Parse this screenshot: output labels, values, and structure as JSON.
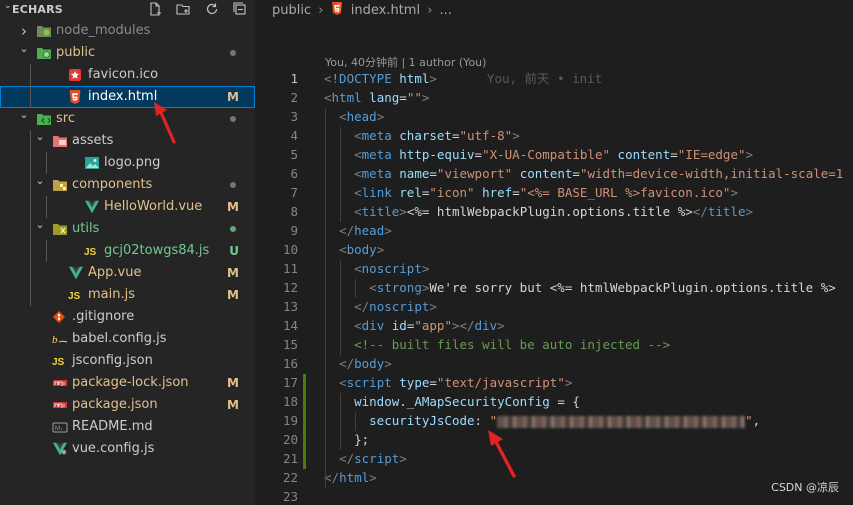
{
  "explorer": {
    "title": "ECHARS",
    "tree": [
      {
        "name": "node_modules",
        "icon": "node-folder-icon",
        "kind": "folder",
        "depth": 0,
        "open": false,
        "color": "#8b8b8b",
        "badge": "",
        "dot": false
      },
      {
        "name": "public",
        "icon": "public-folder-icon",
        "kind": "folder",
        "depth": 0,
        "open": true,
        "color": "#e2c08d",
        "badge": "",
        "dot": true
      },
      {
        "name": "favicon.ico",
        "icon": "favicon-icon",
        "kind": "file",
        "depth": 1,
        "color": "#cccccc",
        "badge": "",
        "dot": false
      },
      {
        "name": "index.html",
        "icon": "html5-icon",
        "kind": "file",
        "depth": 1,
        "color": "#e2c08d",
        "badge": "M",
        "badgeColor": "#e2c08d",
        "dot": false,
        "selected": true
      },
      {
        "name": "src",
        "icon": "src-folder-icon",
        "kind": "folder",
        "depth": 0,
        "open": true,
        "color": "#e2c08d",
        "badge": "",
        "dot": true
      },
      {
        "name": "assets",
        "icon": "assets-folder-icon",
        "kind": "folder",
        "depth": 1,
        "open": true,
        "color": "#cccccc",
        "badge": "",
        "dot": false
      },
      {
        "name": "logo.png",
        "icon": "image-icon",
        "kind": "file",
        "depth": 2,
        "color": "#cccccc",
        "badge": "",
        "dot": false
      },
      {
        "name": "components",
        "icon": "components-folder-icon",
        "kind": "folder",
        "depth": 1,
        "open": true,
        "color": "#e2c08d",
        "badge": "",
        "dot": true
      },
      {
        "name": "HelloWorld.vue",
        "icon": "vue-icon",
        "kind": "file",
        "depth": 2,
        "color": "#e2c08d",
        "badge": "M",
        "badgeColor": "#e2c08d",
        "dot": false
      },
      {
        "name": "utils",
        "icon": "utils-folder-icon",
        "kind": "folder",
        "depth": 1,
        "open": true,
        "color": "#73c991",
        "badge": "",
        "dot": true,
        "dotColor": "#73c991"
      },
      {
        "name": "gcj02towgs84.js",
        "icon": "js-icon",
        "kind": "file",
        "depth": 2,
        "color": "#73c991",
        "badge": "U",
        "badgeColor": "#73c991",
        "dot": false
      },
      {
        "name": "App.vue",
        "icon": "vue-icon",
        "kind": "file",
        "depth": 1,
        "color": "#e2c08d",
        "badge": "M",
        "badgeColor": "#e2c08d",
        "dot": false
      },
      {
        "name": "main.js",
        "icon": "js-icon",
        "kind": "file",
        "depth": 1,
        "color": "#e2c08d",
        "badge": "M",
        "badgeColor": "#e2c08d",
        "dot": false
      },
      {
        "name": ".gitignore",
        "icon": "git-icon",
        "kind": "file",
        "depth": 0,
        "color": "#cccccc",
        "badge": "",
        "dot": false
      },
      {
        "name": "babel.config.js",
        "icon": "babel-icon",
        "kind": "file",
        "depth": 0,
        "color": "#cccccc",
        "badge": "",
        "dot": false
      },
      {
        "name": "jsconfig.json",
        "icon": "js-icon",
        "kind": "file",
        "depth": 0,
        "color": "#cccccc",
        "badge": "",
        "dot": false
      },
      {
        "name": "package-lock.json",
        "icon": "npm-icon",
        "kind": "file",
        "depth": 0,
        "color": "#e2c08d",
        "badge": "M",
        "badgeColor": "#e2c08d",
        "dot": false
      },
      {
        "name": "package.json",
        "icon": "npm-icon",
        "kind": "file",
        "depth": 0,
        "color": "#e2c08d",
        "badge": "M",
        "badgeColor": "#e2c08d",
        "dot": false
      },
      {
        "name": "README.md",
        "icon": "markdown-icon",
        "kind": "file",
        "depth": 0,
        "color": "#cccccc",
        "badge": "",
        "dot": false
      },
      {
        "name": "vue.config.js",
        "icon": "vue-config-icon",
        "kind": "file",
        "depth": 0,
        "color": "#cccccc",
        "badge": "",
        "dot": false
      }
    ]
  },
  "breadcrumb": {
    "folder": "public",
    "file": "index.html",
    "more": "..."
  },
  "blame": "You, 40分钟前 | 1 author (You)",
  "ghost_text": "You, 前天 • init",
  "code": [
    [
      [
        "t-punc",
        "<"
      ],
      [
        "t-tag",
        "!DOCTYPE"
      ],
      [
        "t-text",
        " "
      ],
      [
        "t-attr",
        "html"
      ],
      [
        "t-punc",
        ">"
      ]
    ],
    [
      [
        "t-punc",
        "<"
      ],
      [
        "t-tag",
        "html"
      ],
      [
        "t-text",
        " "
      ],
      [
        "t-attr",
        "lang"
      ],
      [
        "t-text",
        "="
      ],
      [
        "t-str",
        "\"\""
      ],
      [
        "t-punc",
        ">"
      ]
    ],
    [
      [
        "t-text",
        "  "
      ],
      [
        "t-punc",
        "<"
      ],
      [
        "t-tag",
        "head"
      ],
      [
        "t-punc",
        ">"
      ]
    ],
    [
      [
        "t-text",
        "    "
      ],
      [
        "t-punc",
        "<"
      ],
      [
        "t-tag",
        "meta"
      ],
      [
        "t-text",
        " "
      ],
      [
        "t-attr",
        "charset"
      ],
      [
        "t-text",
        "="
      ],
      [
        "t-str",
        "\"utf-8\""
      ],
      [
        "t-punc",
        ">"
      ]
    ],
    [
      [
        "t-text",
        "    "
      ],
      [
        "t-punc",
        "<"
      ],
      [
        "t-tag",
        "meta"
      ],
      [
        "t-text",
        " "
      ],
      [
        "t-attr",
        "http-equiv"
      ],
      [
        "t-text",
        "="
      ],
      [
        "t-str",
        "\"X-UA-Compatible\""
      ],
      [
        "t-text",
        " "
      ],
      [
        "t-attr",
        "content"
      ],
      [
        "t-text",
        "="
      ],
      [
        "t-str",
        "\"IE=edge\""
      ],
      [
        "t-punc",
        ">"
      ]
    ],
    [
      [
        "t-text",
        "    "
      ],
      [
        "t-punc",
        "<"
      ],
      [
        "t-tag",
        "meta"
      ],
      [
        "t-text",
        " "
      ],
      [
        "t-attr",
        "name"
      ],
      [
        "t-text",
        "="
      ],
      [
        "t-str",
        "\"viewport\""
      ],
      [
        "t-text",
        " "
      ],
      [
        "t-attr",
        "content"
      ],
      [
        "t-text",
        "="
      ],
      [
        "t-str",
        "\"width=device-width,initial-scale=1"
      ]
    ],
    [
      [
        "t-text",
        "    "
      ],
      [
        "t-punc",
        "<"
      ],
      [
        "t-tag",
        "link"
      ],
      [
        "t-text",
        " "
      ],
      [
        "t-attr",
        "rel"
      ],
      [
        "t-text",
        "="
      ],
      [
        "t-str",
        "\"icon\""
      ],
      [
        "t-text",
        " "
      ],
      [
        "t-attr",
        "href"
      ],
      [
        "t-text",
        "="
      ],
      [
        "t-str",
        "\"<%= BASE_URL %>favicon.ico\""
      ],
      [
        "t-punc",
        ">"
      ]
    ],
    [
      [
        "t-text",
        "    "
      ],
      [
        "t-punc",
        "<"
      ],
      [
        "t-tag",
        "title"
      ],
      [
        "t-punc",
        ">"
      ],
      [
        "t-text",
        "<%= htmlWebpackPlugin.options.title %>"
      ],
      [
        "t-punc",
        "</"
      ],
      [
        "t-tag",
        "title"
      ],
      [
        "t-punc",
        ">"
      ]
    ],
    [
      [
        "t-text",
        "  "
      ],
      [
        "t-punc",
        "</"
      ],
      [
        "t-tag",
        "head"
      ],
      [
        "t-punc",
        ">"
      ]
    ],
    [
      [
        "t-text",
        "  "
      ],
      [
        "t-punc",
        "<"
      ],
      [
        "t-tag",
        "body"
      ],
      [
        "t-punc",
        ">"
      ]
    ],
    [
      [
        "t-text",
        "    "
      ],
      [
        "t-punc",
        "<"
      ],
      [
        "t-tag",
        "noscript"
      ],
      [
        "t-punc",
        ">"
      ]
    ],
    [
      [
        "t-text",
        "      "
      ],
      [
        "t-punc",
        "<"
      ],
      [
        "t-tag",
        "strong"
      ],
      [
        "t-punc",
        ">"
      ],
      [
        "t-text",
        "We're sorry but <%= htmlWebpackPlugin.options.title %> "
      ]
    ],
    [
      [
        "t-text",
        "    "
      ],
      [
        "t-punc",
        "</"
      ],
      [
        "t-tag",
        "noscript"
      ],
      [
        "t-punc",
        ">"
      ]
    ],
    [
      [
        "t-text",
        "    "
      ],
      [
        "t-punc",
        "<"
      ],
      [
        "t-tag",
        "div"
      ],
      [
        "t-text",
        " "
      ],
      [
        "t-attr",
        "id"
      ],
      [
        "t-text",
        "="
      ],
      [
        "t-str",
        "\"app\""
      ],
      [
        "t-punc",
        "></"
      ],
      [
        "t-tag",
        "div"
      ],
      [
        "t-punc",
        ">"
      ]
    ],
    [
      [
        "t-text",
        "    "
      ],
      [
        "t-cm",
        "<!-- built files will be auto injected -->"
      ]
    ],
    [
      [
        "t-text",
        "  "
      ],
      [
        "t-punc",
        "</"
      ],
      [
        "t-tag",
        "body"
      ],
      [
        "t-punc",
        ">"
      ]
    ],
    [
      [
        "t-text",
        "  "
      ],
      [
        "t-punc",
        "<"
      ],
      [
        "t-tag",
        "script"
      ],
      [
        "t-text",
        " "
      ],
      [
        "t-attr",
        "type"
      ],
      [
        "t-text",
        "="
      ],
      [
        "t-str",
        "\"text/javascript\""
      ],
      [
        "t-punc",
        ">"
      ]
    ],
    [
      [
        "t-text",
        "    "
      ],
      [
        "t-var",
        "window"
      ],
      [
        "t-text",
        "."
      ],
      [
        "t-var",
        "_AMapSecurityConfig"
      ],
      [
        "t-text",
        " = {"
      ]
    ],
    [
      [
        "t-text",
        "      "
      ],
      [
        "t-var",
        "securityJsCode"
      ],
      [
        "t-text",
        ": "
      ],
      [
        "t-str",
        "\""
      ],
      [
        "blur",
        ""
      ],
      [
        "t-str",
        "\""
      ],
      [
        "t-text",
        ","
      ]
    ],
    [
      [
        "t-text",
        "    };"
      ]
    ],
    [
      [
        "t-text",
        "  "
      ],
      [
        "t-punc",
        "</"
      ],
      [
        "t-tag",
        "script"
      ],
      [
        "t-punc",
        ">"
      ]
    ],
    [
      [
        "t-punc",
        "</"
      ],
      [
        "t-tag",
        "html"
      ],
      [
        "t-punc",
        ">"
      ]
    ],
    []
  ],
  "watermark": "CSDN @凉辰",
  "colors": {
    "accent": "#007fd4",
    "modified": "#e2c08d",
    "untracked": "#73c991",
    "arrow": "#e02424"
  }
}
